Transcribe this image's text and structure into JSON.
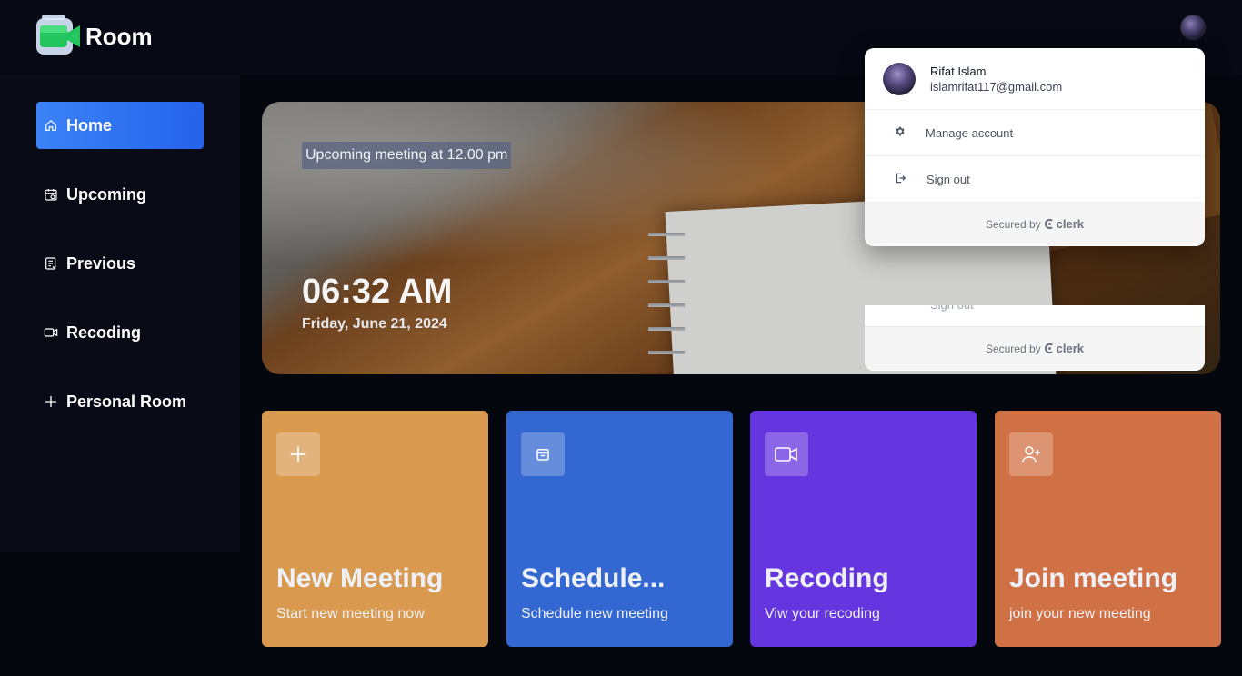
{
  "app": {
    "name": "Room"
  },
  "user": {
    "name": "Rifat Islam",
    "email": "islamrifat117@gmail.com"
  },
  "sidebar": {
    "items": [
      {
        "label": "Home",
        "icon": "home-icon",
        "active": true
      },
      {
        "label": "Upcoming",
        "icon": "calendar-clock-icon",
        "active": false
      },
      {
        "label": "Previous",
        "icon": "list-document-icon",
        "active": false
      },
      {
        "label": "Recoding",
        "icon": "video-camera-icon",
        "active": false
      },
      {
        "label": "Personal Room",
        "icon": "plus-icon",
        "active": false
      }
    ]
  },
  "hero": {
    "badge": "Upcoming meeting at 12.00 pm",
    "time": "06:32 AM",
    "date": "Friday, June 21, 2024"
  },
  "cards": [
    {
      "title": "New Meeting",
      "subtitle": "Start new meeting now",
      "icon": "plus-icon",
      "color": "#D99A50"
    },
    {
      "title": "Schedule...",
      "subtitle": "Schedule new meeting",
      "icon": "calendar-icon",
      "color": "#3367D1"
    },
    {
      "title": "Recoding",
      "subtitle": "Viw your recoding",
      "icon": "video-camera-icon",
      "color": "#6535E0"
    },
    {
      "title": "Join meeting",
      "subtitle": "join your new meeting",
      "icon": "user-plus-icon",
      "color": "#D07045"
    }
  ],
  "dropdown": {
    "manage_label": "Manage account",
    "signout_label": "Sign out",
    "secured_by": "Secured by",
    "brand": "clerk"
  },
  "colors": {
    "accent": "#3B82F6",
    "background": "#05070F",
    "sidebar": "#080B16"
  }
}
